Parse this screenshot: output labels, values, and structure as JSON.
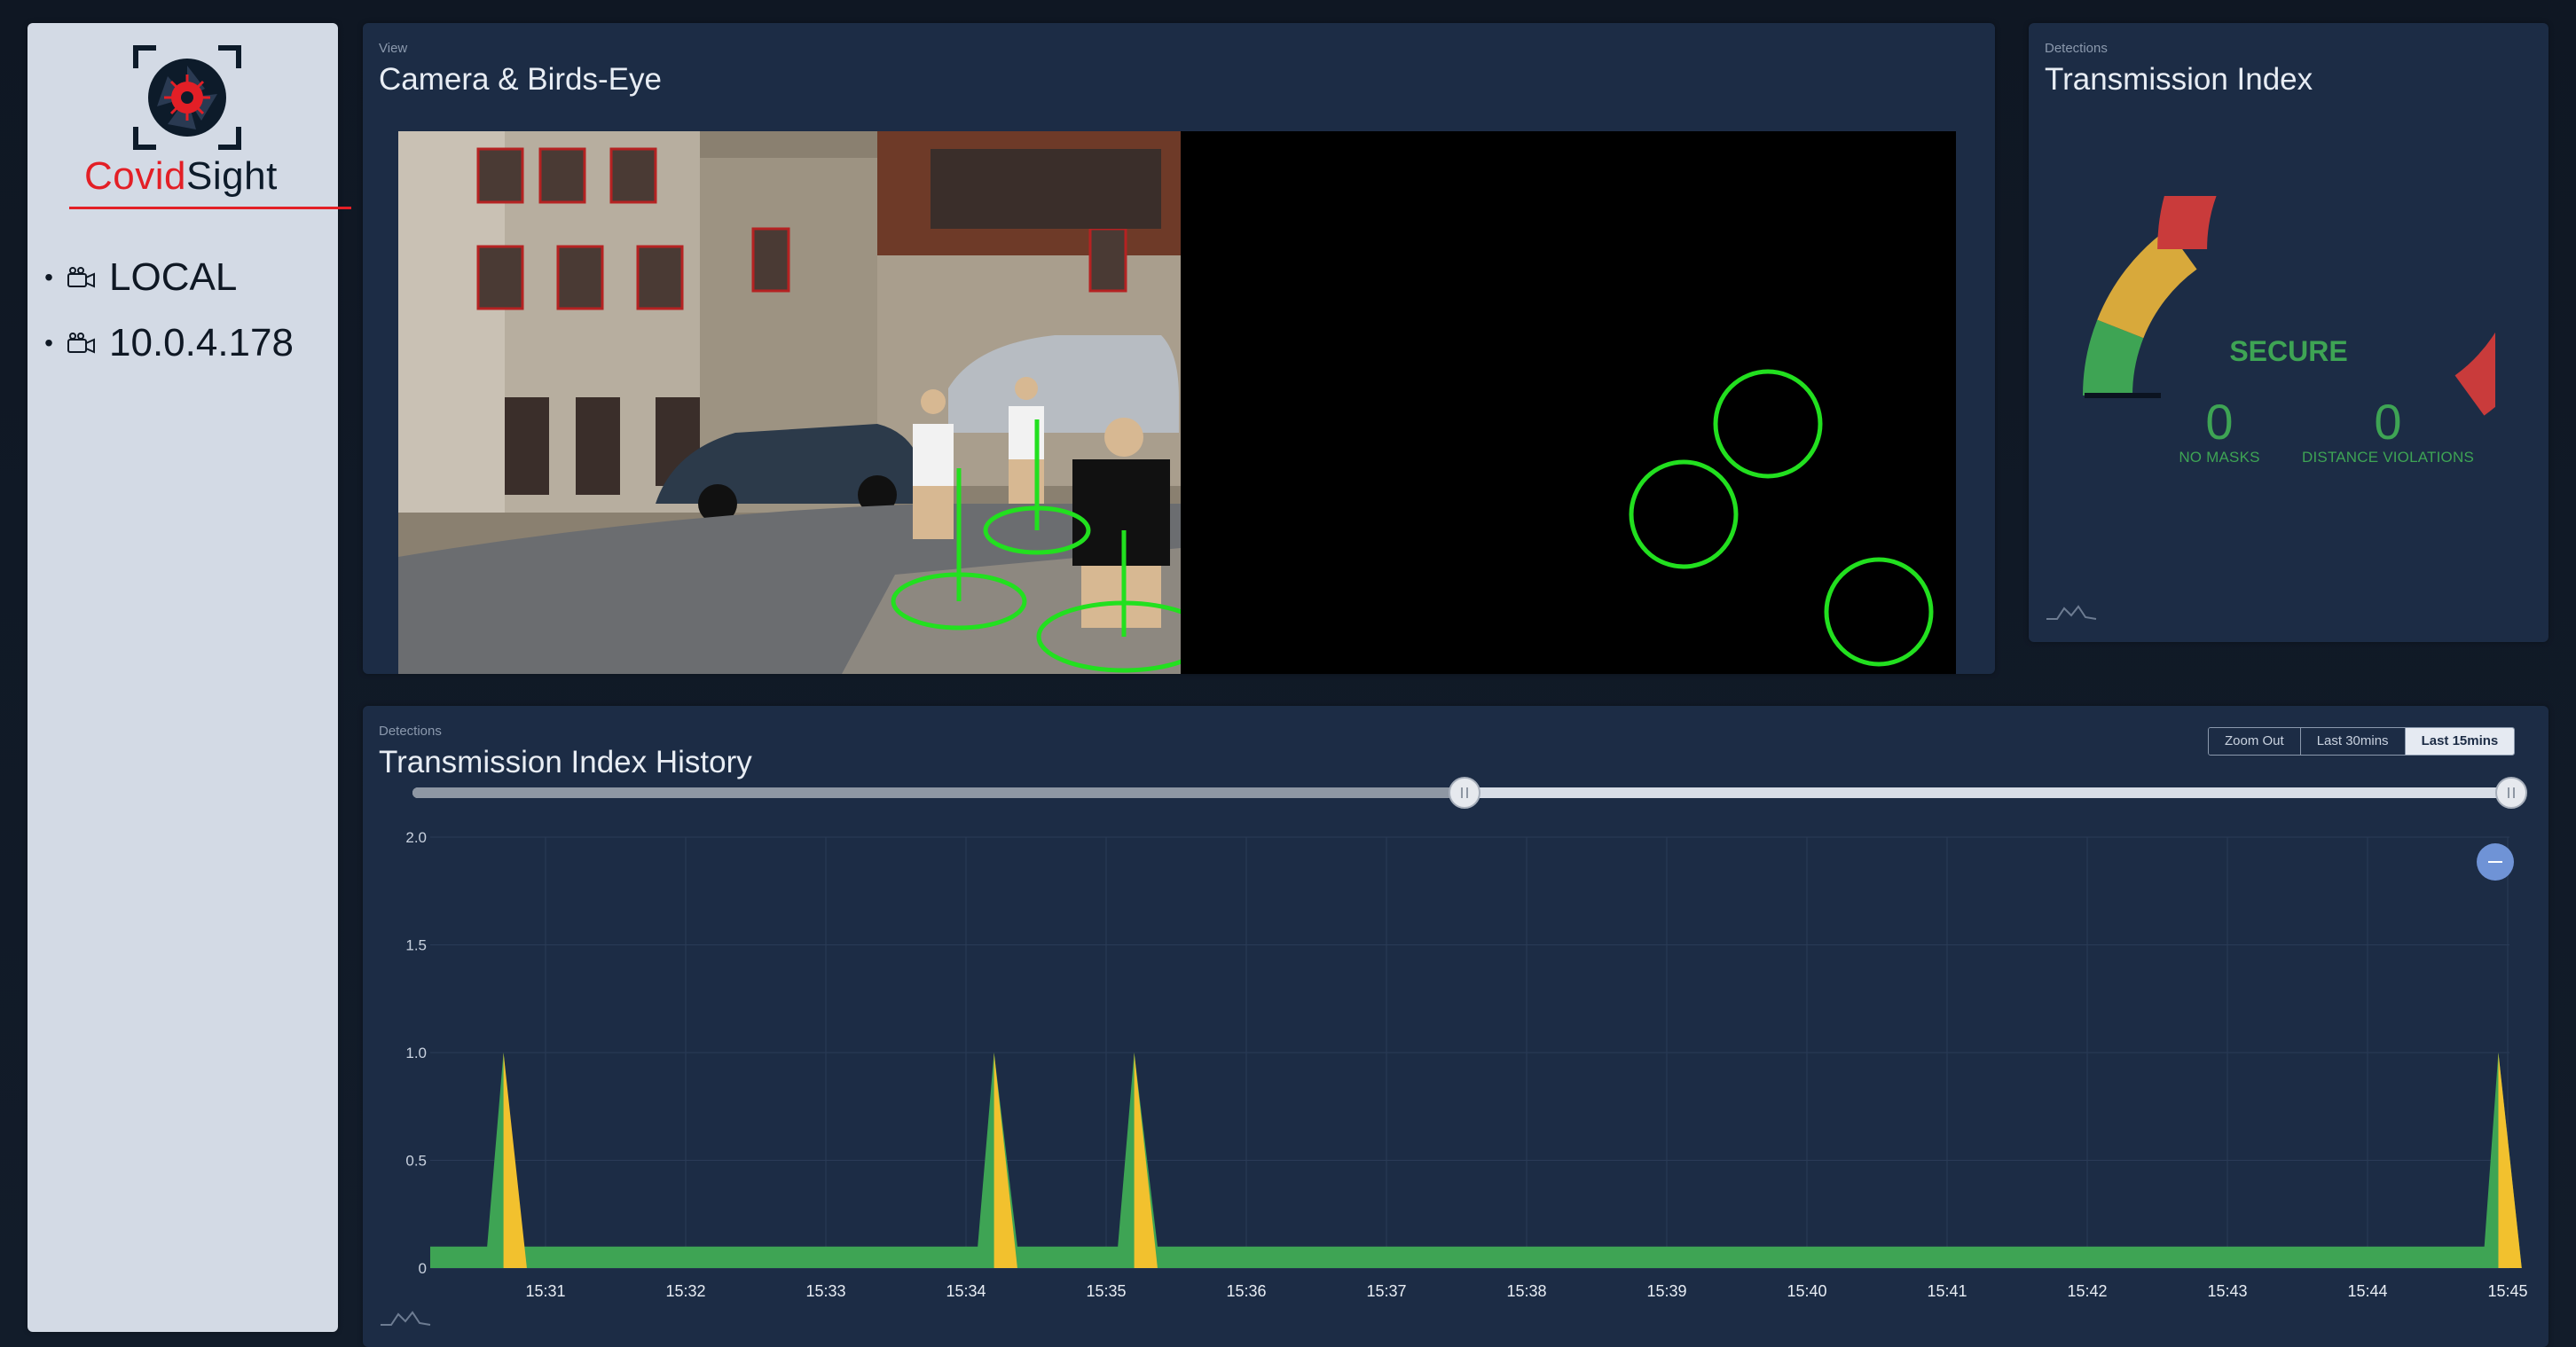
{
  "brand": {
    "name_part1": "Covid",
    "name_part2": "Sight",
    "accent": "#e31f26"
  },
  "sidebar": {
    "items": [
      {
        "label": "LOCAL",
        "icon": "camera-icon"
      },
      {
        "label": "10.0.4.178",
        "icon": "camera-icon"
      }
    ]
  },
  "view_panel": {
    "eyebrow": "View",
    "title": "Camera & Birds-Eye"
  },
  "transmission_panel": {
    "eyebrow": "Detections",
    "title": "Transmission Index",
    "status": "SECURE",
    "gauge_value_fraction": 0.0,
    "gauge_colors": {
      "low": "#3ea454",
      "mid": "#d8a93b",
      "high": "#c93b3b"
    },
    "no_masks": {
      "value": "0",
      "label": "NO MASKS"
    },
    "distance_violations": {
      "value": "0",
      "label": "DISTANCE VIOLATIONS"
    }
  },
  "history_panel": {
    "eyebrow": "Detections",
    "title": "Transmission Index History",
    "zoom_buttons": [
      {
        "label": "Zoom Out",
        "active": false
      },
      {
        "label": "Last 30mins",
        "active": false
      },
      {
        "label": "Last 15mins",
        "active": true
      }
    ],
    "range_slider": {
      "start_fraction": 0.5,
      "end_fraction": 1.0
    }
  },
  "chart_data": {
    "type": "area",
    "title": "Transmission Index History",
    "xlabel": "",
    "ylabel": "",
    "ylim": [
      0,
      2
    ],
    "y_ticks": [
      "0",
      "0.5",
      "1.0",
      "1.5",
      "2.0"
    ],
    "x_ticks": [
      "15:31",
      "15:32",
      "15:33",
      "15:34",
      "15:35",
      "15:36",
      "15:37",
      "15:38",
      "15:39",
      "15:40",
      "15:41",
      "15:42",
      "15:43",
      "15:44",
      "15:45"
    ],
    "grid": true,
    "series": [
      {
        "color": "#3ea454",
        "x": [
          "15:30:15",
          "15:30:35",
          "15:30:42",
          "15:30:50",
          "15:34:05",
          "15:34:12",
          "15:34:22",
          "15:35:05",
          "15:35:12",
          "15:35:22",
          "15:44:50",
          "15:44:56",
          "15:45:06"
        ],
        "values": [
          0.1,
          0.1,
          1.0,
          0.1,
          0.1,
          1.0,
          0.1,
          0.1,
          1.0,
          0.1,
          0.1,
          1.0,
          0.0
        ]
      },
      {
        "color": "#f2c12e",
        "x": [
          "15:30:42",
          "15:30:52",
          "15:34:12",
          "15:34:22",
          "15:35:12",
          "15:35:22",
          "15:44:56",
          "15:45:06"
        ],
        "values": [
          1.0,
          0.0,
          1.0,
          0.0,
          1.0,
          0.0,
          1.0,
          0.0
        ]
      }
    ]
  }
}
